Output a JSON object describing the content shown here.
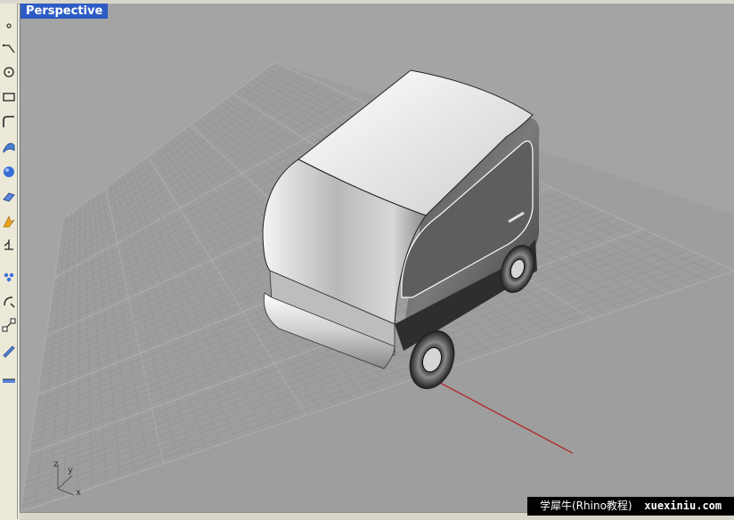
{
  "viewport": {
    "title": "Perspective",
    "axis_labels": {
      "z": "z",
      "y": "y",
      "x": "x"
    }
  },
  "toolbar": {
    "tools": [
      "point-icon",
      "curve-icon",
      "circle-icon",
      "rectangle-icon",
      "fillet-icon",
      "surface-icon",
      "sphere-icon",
      "plane-icon",
      "transform-icon",
      "dimension-icon",
      "mesh-icon",
      "arc-icon",
      "snap-icon",
      "ruler-icon",
      "layer-icon"
    ]
  },
  "watermark": {
    "text": "学犀牛(Rhino教程)",
    "site": "xuexiniu.com"
  },
  "colors": {
    "viewport_bg": "#a4a4a4",
    "grid": "#8f8f8f",
    "grid_major": "#b0b0b0",
    "title_bg": "#2d5cc4",
    "x_axis": "#b03030"
  }
}
